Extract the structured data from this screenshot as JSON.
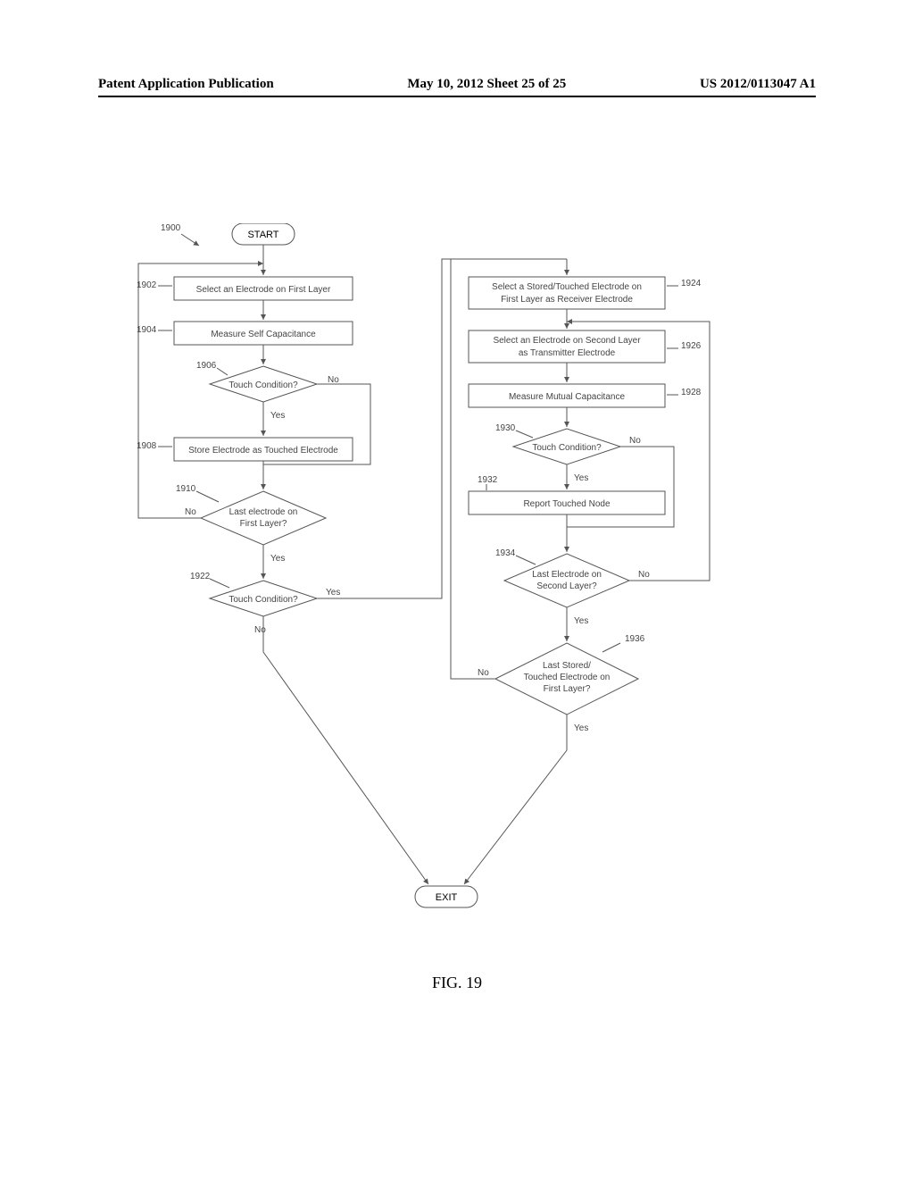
{
  "header": {
    "left": "Patent Application Publication",
    "center": "May 10, 2012  Sheet 25 of 25",
    "right": "US 2012/0113047 A1"
  },
  "figure_label": "FIG. 19",
  "refs": {
    "main": "1900",
    "r1902": "1902",
    "r1904": "1904",
    "r1906": "1906",
    "r1908": "1908",
    "r1910": "1910",
    "r1922": "1922",
    "r1924": "1924",
    "r1926": "1926",
    "r1928": "1928",
    "r1930": "1930",
    "r1932": "1932",
    "r1934": "1934",
    "r1936": "1936"
  },
  "nodes": {
    "start": "START",
    "exit": "EXIT",
    "n1902": "Select an Electrode on First Layer",
    "n1904": "Measure Self Capacitance",
    "n1906": "Touch Condition?",
    "n1908": "Store Electrode as Touched Electrode",
    "n1910_l1": "Last electrode on",
    "n1910_l2": "First Layer?",
    "n1922": "Touch Condition?",
    "n1924_l1": "Select a Stored/Touched Electrode on",
    "n1924_l2": "First Layer as Receiver Electrode",
    "n1926_l1": "Select an Electrode on Second Layer",
    "n1926_l2": "as Transmitter Electrode",
    "n1928": "Measure Mutual Capacitance",
    "n1930": "Touch Condition?",
    "n1932": "Report Touched Node",
    "n1934_l1": "Last Electrode on",
    "n1934_l2": "Second Layer?",
    "n1936_l1": "Last Stored/",
    "n1936_l2": "Touched Electrode on",
    "n1936_l3": "First Layer?"
  },
  "edge_labels": {
    "yes": "Yes",
    "no": "No"
  }
}
